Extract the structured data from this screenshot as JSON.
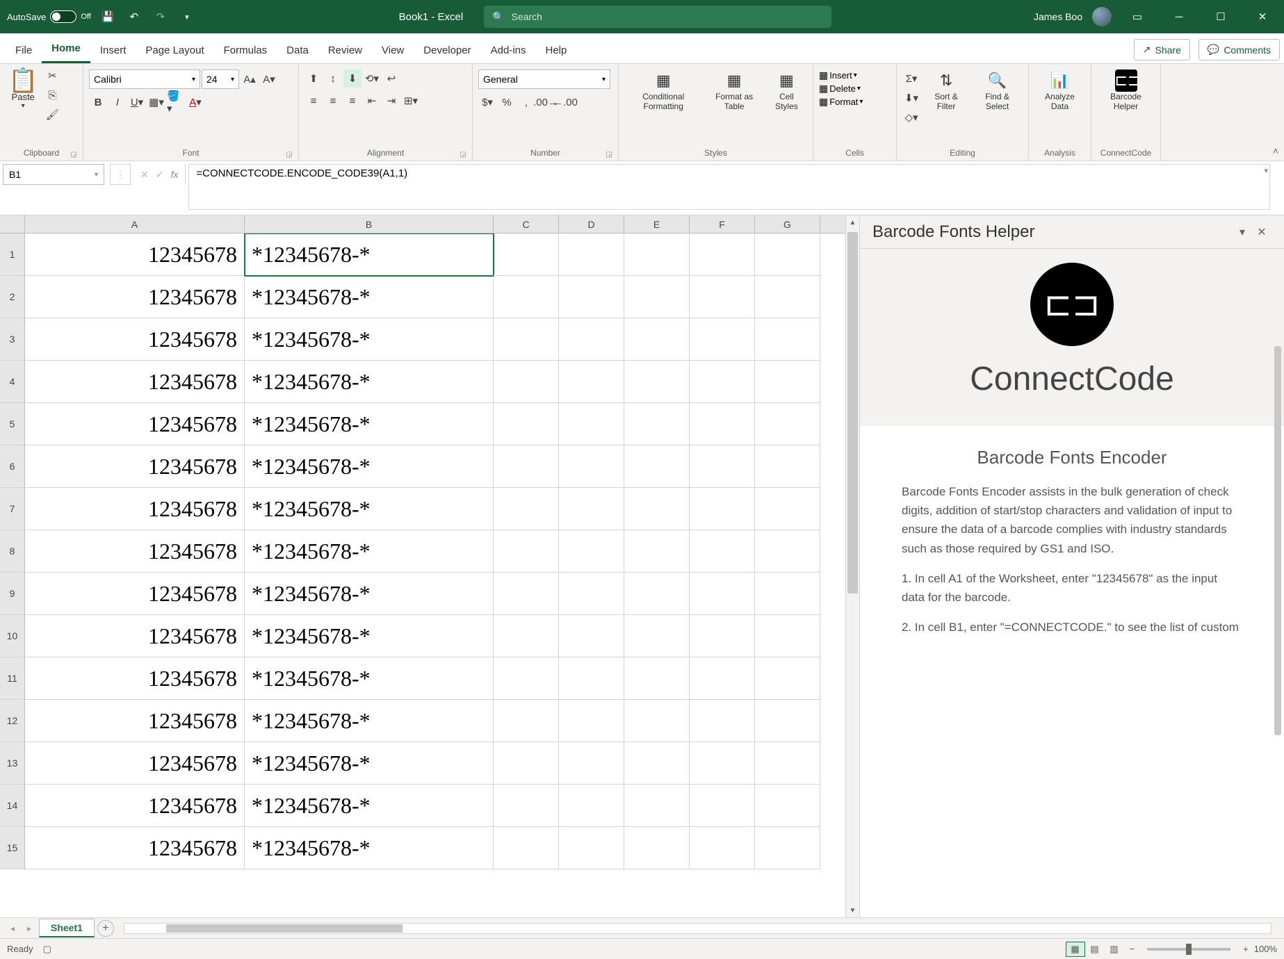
{
  "titlebar": {
    "autosave_label": "AutoSave",
    "autosave_state": "Off",
    "doc_title": "Book1 - Excel",
    "search_placeholder": "Search",
    "user_name": "James Boo"
  },
  "tabs": [
    "File",
    "Home",
    "Insert",
    "Page Layout",
    "Formulas",
    "Data",
    "Review",
    "View",
    "Developer",
    "Add-ins",
    "Help"
  ],
  "active_tab": "Home",
  "share_label": "Share",
  "comments_label": "Comments",
  "ribbon": {
    "clipboard": {
      "paste": "Paste",
      "label": "Clipboard"
    },
    "font": {
      "name": "Calibri",
      "size": "24",
      "label": "Font"
    },
    "alignment": {
      "label": "Alignment"
    },
    "number": {
      "format": "General",
      "label": "Number"
    },
    "styles": {
      "cond": "Conditional Formatting",
      "table": "Format as Table",
      "cell": "Cell Styles",
      "label": "Styles"
    },
    "cells": {
      "insert": "Insert",
      "delete": "Delete",
      "format": "Format",
      "label": "Cells"
    },
    "editing": {
      "sort": "Sort & Filter",
      "find": "Find & Select",
      "label": "Editing"
    },
    "analysis": {
      "analyze": "Analyze Data",
      "label": "Analysis"
    },
    "connectcode": {
      "helper": "Barcode Helper",
      "label": "ConnectCode"
    }
  },
  "formula_bar": {
    "name_box": "B1",
    "formula": "=CONNECTCODE.ENCODE_CODE39(A1,1)"
  },
  "grid": {
    "columns": [
      "A",
      "B",
      "C",
      "D",
      "E",
      "F",
      "G"
    ],
    "row_count": 15,
    "selected_cell": "B1",
    "data": {
      "A": [
        "12345678",
        "12345678",
        "12345678",
        "12345678",
        "12345678",
        "12345678",
        "12345678",
        "12345678",
        "12345678",
        "12345678",
        "12345678",
        "12345678",
        "12345678",
        "12345678",
        "12345678"
      ],
      "B": [
        "*12345678-*",
        "*12345678-*",
        "*12345678-*",
        "*12345678-*",
        "*12345678-*",
        "*12345678-*",
        "*12345678-*",
        "*12345678-*",
        "*12345678-*",
        "*12345678-*",
        "*12345678-*",
        "*12345678-*",
        "*12345678-*",
        "*12345678-*",
        "*12345678-*"
      ]
    }
  },
  "taskpane": {
    "title": "Barcode Fonts Helper",
    "brand": "ConnectCode",
    "section_title": "Barcode Fonts Encoder",
    "para1": "Barcode Fonts Encoder assists in the bulk generation of check digits, addition of start/stop characters and validation of input to ensure the data of a barcode complies with industry standards such as those required by GS1 and ISO.",
    "step1": "1. In cell A1 of the Worksheet, enter \"12345678\" as the input data for the barcode.",
    "step2": "2. In cell B1, enter \"=CONNECTCODE.\" to see the list of custom"
  },
  "sheet_tabs": {
    "active": "Sheet1"
  },
  "statusbar": {
    "ready": "Ready",
    "zoom": "100%"
  }
}
